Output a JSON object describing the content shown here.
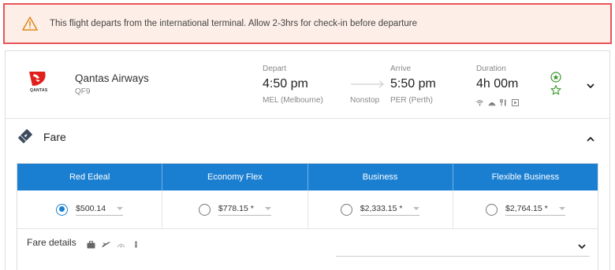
{
  "alert": {
    "message": "This flight departs from the international terminal. Allow 2-3hrs for check-in before departure"
  },
  "flight": {
    "airline": "Qantas Airways",
    "logo_text": "QANTAS",
    "flight_number": "QF9",
    "depart_label": "Depart",
    "depart_time": "4:50 pm",
    "depart_airport": "MEL (Melbourne)",
    "stops": "Nonstop",
    "arrive_label": "Arrive",
    "arrive_time": "5:50 pm",
    "arrive_airport": "PER (Perth)",
    "duration_label": "Duration",
    "duration": "4h 00m",
    "amenities": [
      "wifi-icon",
      "meal-icon",
      "cutlery-icon",
      "entertainment-icon"
    ]
  },
  "fare_section": {
    "title": "Fare",
    "columns": [
      {
        "name": "Red Edeal",
        "price": "$500.14",
        "selected": true
      },
      {
        "name": "Economy Flex",
        "price": "$778.15 *",
        "selected": false
      },
      {
        "name": "Business",
        "price": "$2,333.15 *",
        "selected": false
      },
      {
        "name": "Flexible Business",
        "price": "$2,764.15 *",
        "selected": false
      }
    ],
    "details_label": "Fare details"
  },
  "colors": {
    "accent": "#1b7fd1",
    "alert_border": "#e8555a",
    "alert_bg": "#fdefe7",
    "warning_icon": "#e08a1e",
    "star_green": "#3a9a2b",
    "qantas_red": "#e0201b"
  }
}
